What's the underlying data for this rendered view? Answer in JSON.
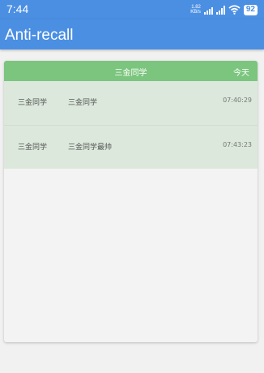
{
  "status_bar": {
    "time": "7:44",
    "net_speed_top": "1.82",
    "net_speed_bottom": "KB/s",
    "battery": "92"
  },
  "app": {
    "title": "Anti-recall"
  },
  "card": {
    "header_title": "三金同学",
    "header_date": "今天",
    "rows": [
      {
        "sender": "三金同学",
        "message": "三金同学",
        "time": "07:40:29"
      },
      {
        "sender": "三金同学",
        "message": "三金同学最帅",
        "time": "07:43:23"
      }
    ]
  },
  "colors": {
    "primary": "#4b8fe3",
    "header_green": "#7bc57e",
    "row_bg": "#dbe8db"
  }
}
